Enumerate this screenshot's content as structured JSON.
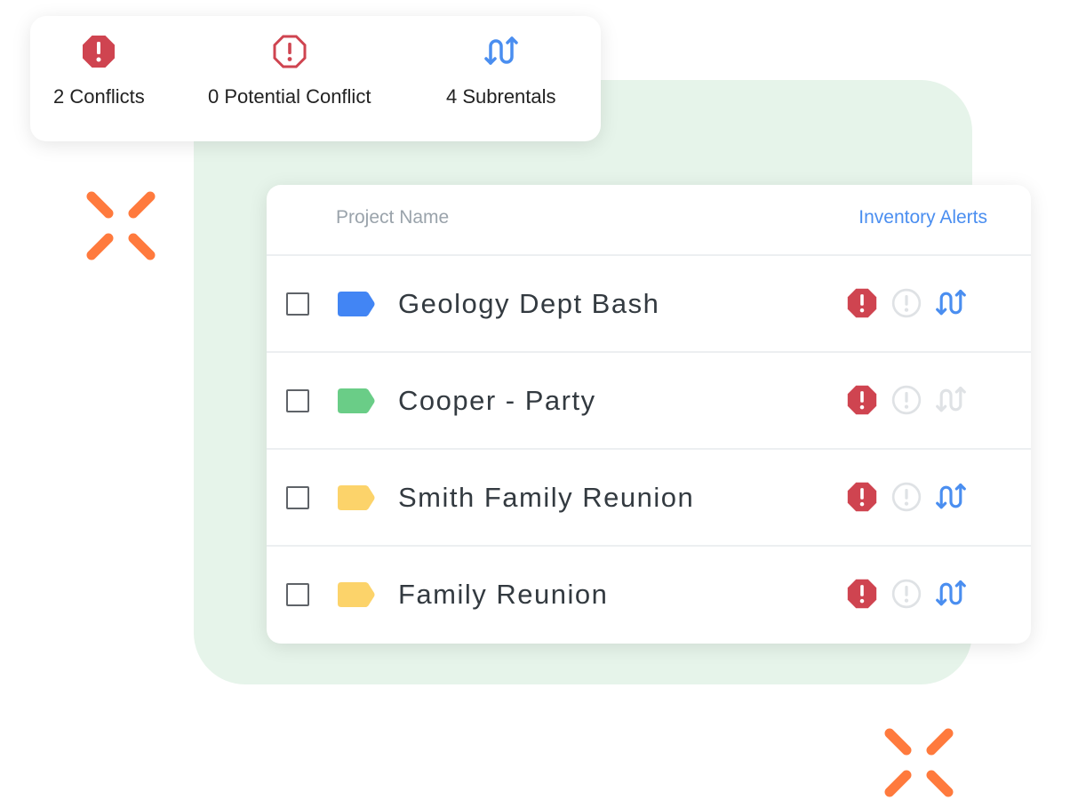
{
  "colors": {
    "conflict_red": "#cf4450",
    "potential_gray": "#dfe2e5",
    "subrental_blue": "#4a8ef0",
    "subrental_inactive": "#dfe2e5",
    "accent_orange": "#ff7a3d",
    "panel_green": "#e6f4ea"
  },
  "summary": {
    "conflicts": {
      "label": "2 Conflicts",
      "icon": "octagon-alert-filled-icon"
    },
    "potential": {
      "label": "0 Potential Conflict",
      "icon": "octagon-alert-outline-icon"
    },
    "subrentals": {
      "label": "4 Subrentals",
      "icon": "swap-vertical-arrows-icon"
    }
  },
  "table": {
    "header": {
      "project_name": "Project Name",
      "inventory_alerts": "Inventory Alerts"
    },
    "rows": [
      {
        "name": "Geology Dept Bash",
        "tag_color": "#4285f4",
        "conflict": true,
        "potential": false,
        "subrental": true
      },
      {
        "name": "Cooper - Party",
        "tag_color": "#6acd87",
        "conflict": true,
        "potential": false,
        "subrental": false
      },
      {
        "name": "Smith Family Reunion",
        "tag_color": "#fcd36a",
        "conflict": true,
        "potential": false,
        "subrental": true
      },
      {
        "name": "Family Reunion",
        "tag_color": "#fcd36a",
        "conflict": true,
        "potential": false,
        "subrental": true
      }
    ]
  }
}
